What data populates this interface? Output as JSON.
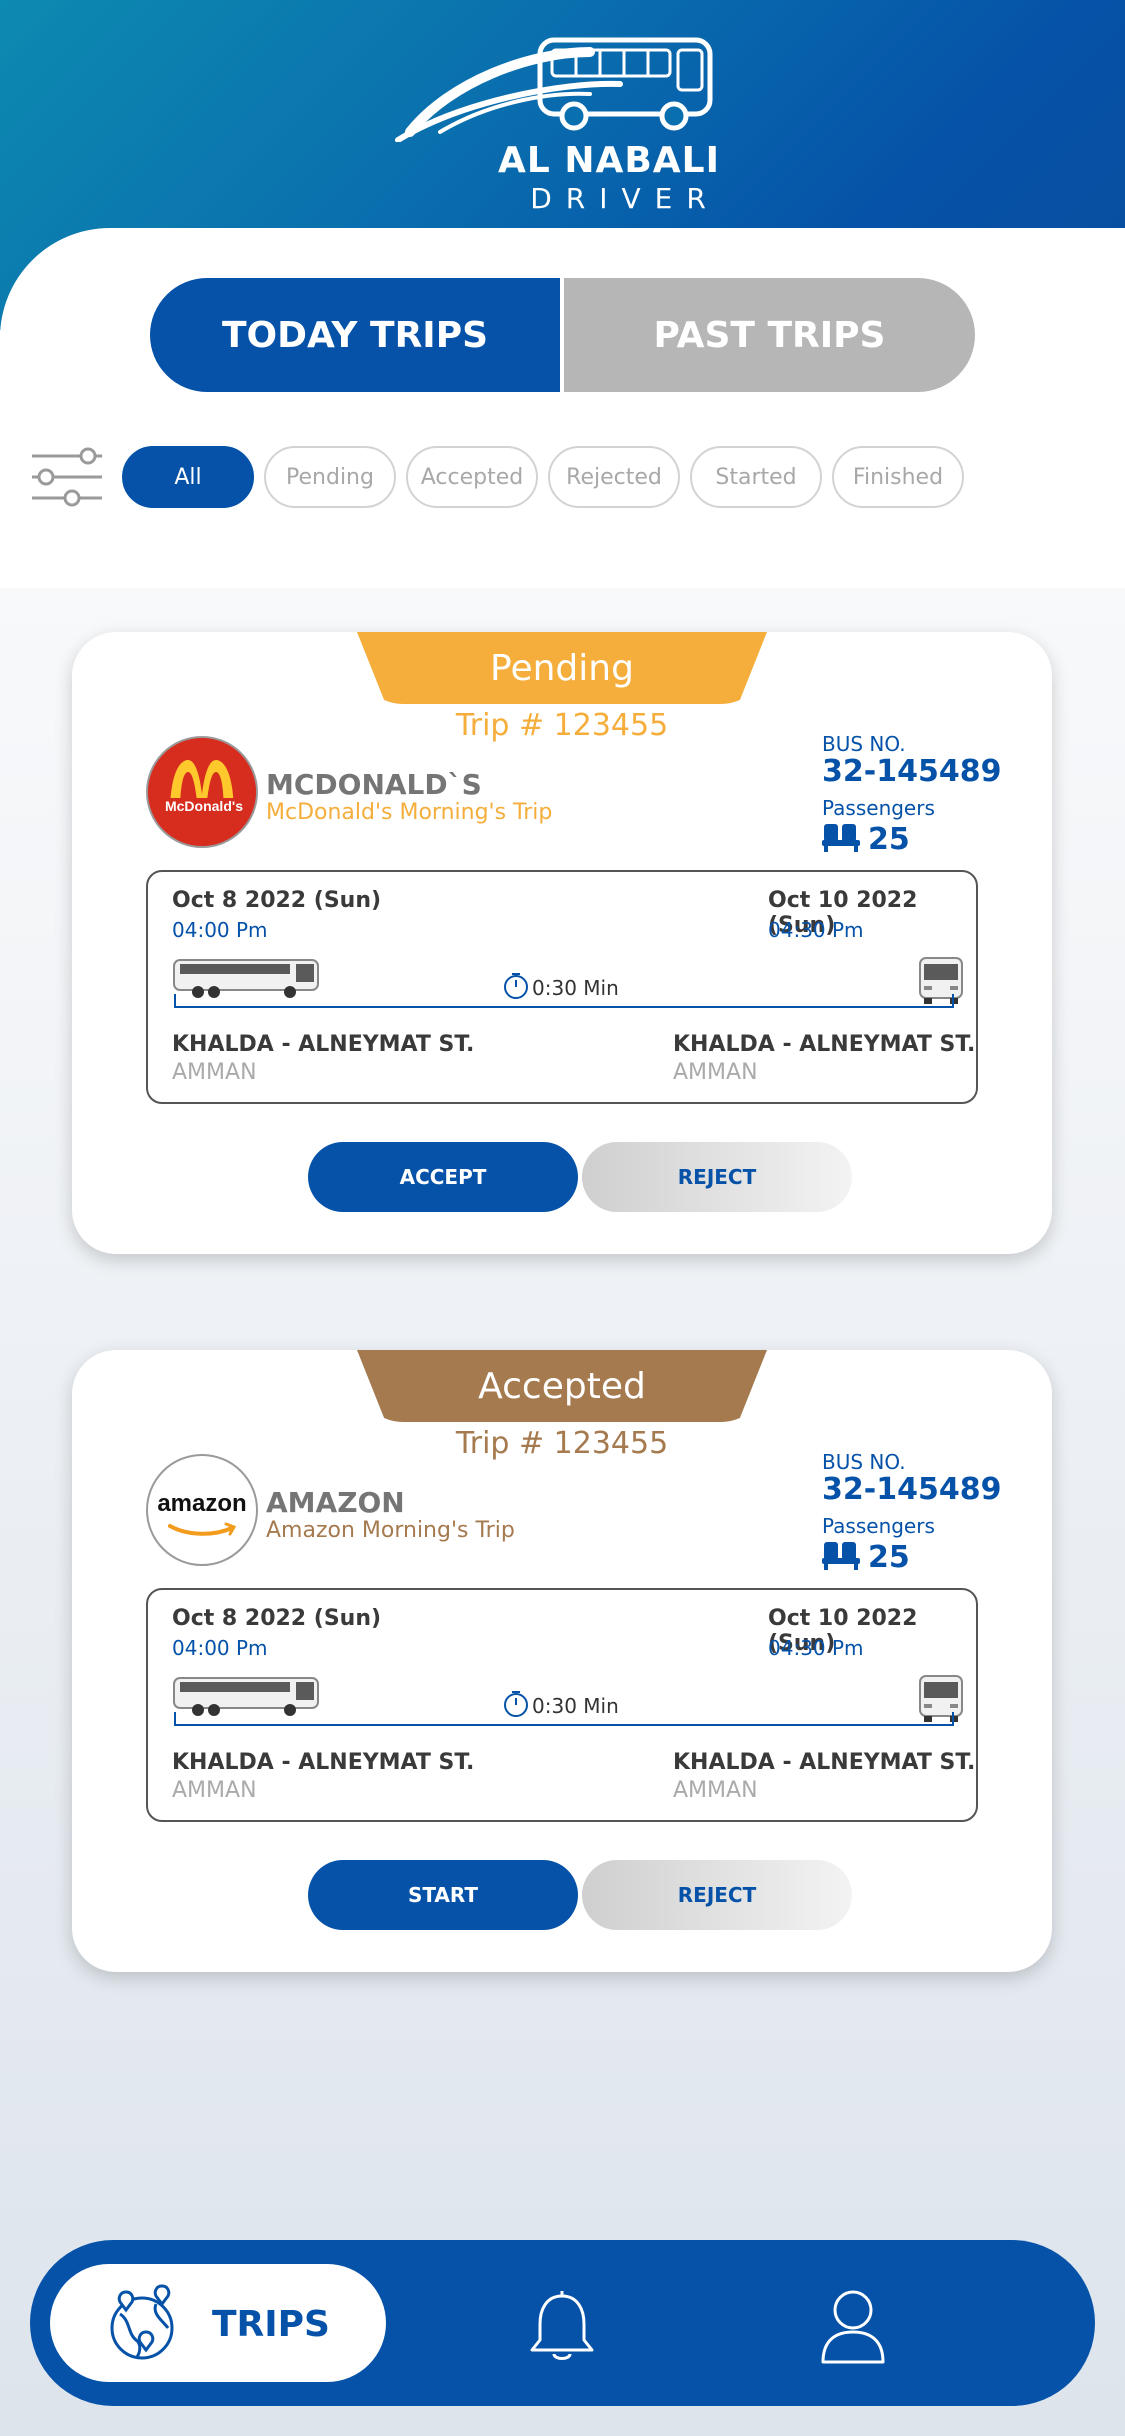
{
  "header": {
    "brand": "AL NABALI",
    "subtitle": "DRIVER"
  },
  "tabs": [
    {
      "label": "TODAY TRIPS",
      "active": true
    },
    {
      "label": "PAST TRIPS",
      "active": false
    }
  ],
  "filters": {
    "icon": "filter-sliders-icon",
    "chips": [
      {
        "label": "All",
        "active": true
      },
      {
        "label": "Pending",
        "active": false
      },
      {
        "label": "Accepted",
        "active": false
      },
      {
        "label": "Rejected",
        "active": false
      },
      {
        "label": "Started",
        "active": false
      },
      {
        "label": "Finished",
        "active": false
      }
    ]
  },
  "trips": [
    {
      "status": "Pending",
      "status_color": "#f5ae3c",
      "accent_color": "#f5ae3c",
      "trip_no": "Trip # 123455",
      "company": "MCDONALD`S",
      "company_logo_text": "McDonald's",
      "description": "McDonald's Morning's Trip",
      "bus_label": "BUS NO.",
      "bus_no": "32-145489",
      "passengers_label": "Passengers",
      "passengers": "25",
      "depart_date": "Oct 8 2022 (Sun)",
      "depart_time": "04:00 Pm",
      "arrive_date": "Oct 10 2022 (Sun)",
      "arrive_time": "04:30 Pm",
      "duration": "0:30 Min",
      "from_location": "KHALDA - ALNEYMAT ST.",
      "from_city": "AMMAN",
      "to_location": "KHALDA - ALNEYMAT ST.",
      "to_city": "AMMAN",
      "primary_action": "ACCEPT",
      "secondary_action": "REJECT"
    },
    {
      "status": "Accepted",
      "status_color": "#a57a4f",
      "accent_color": "#a57a4f",
      "trip_no": "Trip # 123455",
      "company": "AMAZON",
      "company_logo_text": "amazon",
      "description": "Amazon Morning's Trip",
      "bus_label": "BUS NO.",
      "bus_no": "32-145489",
      "passengers_label": "Passengers",
      "passengers": "25",
      "depart_date": "Oct 8 2022 (Sun)",
      "depart_time": "04:00 Pm",
      "arrive_date": "Oct 10 2022 (Sun)",
      "arrive_time": "04:30 Pm",
      "duration": "0:30 Min",
      "from_location": "KHALDA - ALNEYMAT ST.",
      "from_city": "AMMAN",
      "to_location": "KHALDA - ALNEYMAT ST.",
      "to_city": "AMMAN",
      "primary_action": "START",
      "secondary_action": "REJECT"
    }
  ],
  "nav": {
    "items": [
      {
        "label": "TRIPS",
        "icon": "trips-globe-icon",
        "active": true
      },
      {
        "label": "",
        "icon": "bell-icon",
        "active": false
      },
      {
        "label": "",
        "icon": "user-icon",
        "active": false
      }
    ]
  },
  "colors": {
    "primary": "#0552a8",
    "inactive_tab": "#b6b6b6"
  }
}
